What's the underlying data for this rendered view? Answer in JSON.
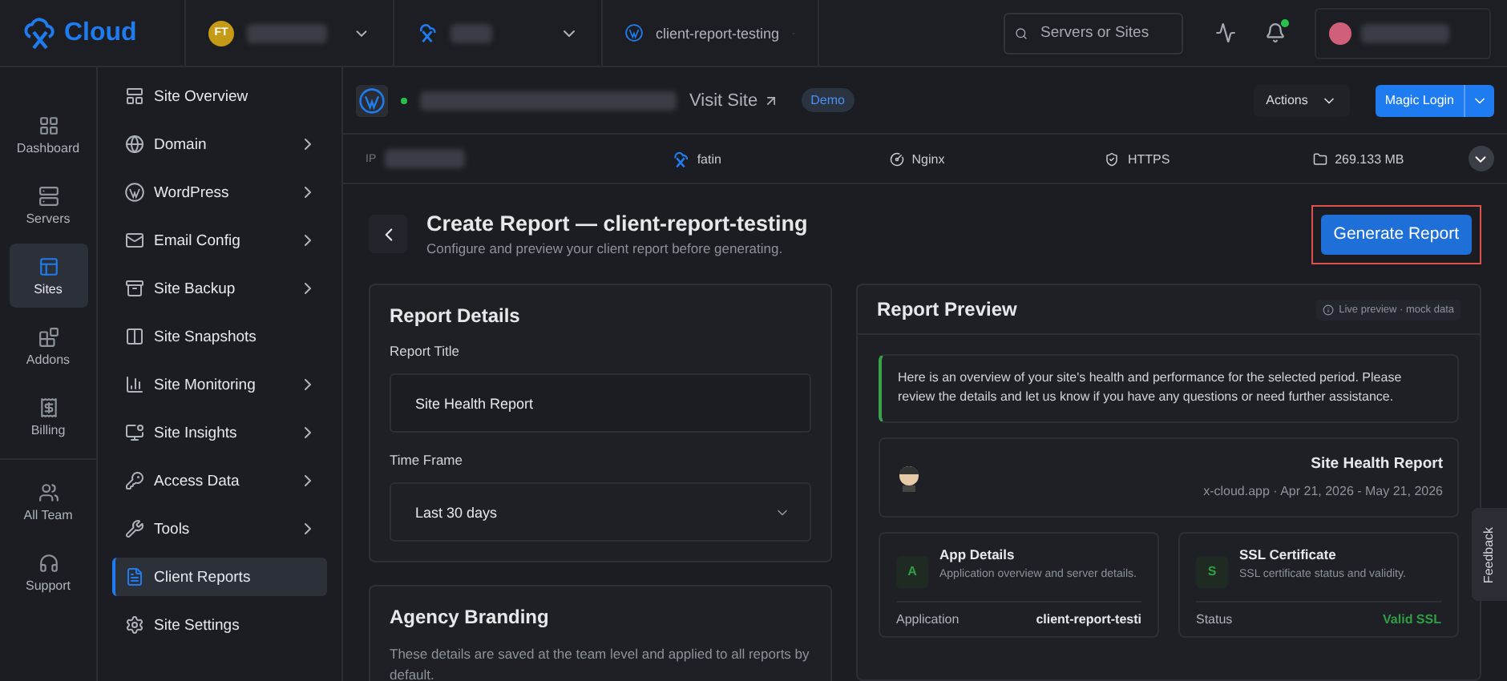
{
  "topbar": {
    "logo_text": "Cloud",
    "team": {
      "initials": "FT"
    },
    "site_crumb": "client-report-testing",
    "search": {
      "placeholder": "Servers or Sites"
    },
    "notifications": {
      "unread": true
    }
  },
  "rail": [
    {
      "label": "Dashboard",
      "selected": false
    },
    {
      "label": "Servers",
      "selected": false
    },
    {
      "label": "Sites",
      "selected": true
    },
    {
      "label": "Addons",
      "selected": false
    },
    {
      "label": "Billing",
      "selected": false
    },
    {
      "label": "All Team",
      "selected": false
    },
    {
      "label": "Support",
      "selected": false
    }
  ],
  "menu": [
    {
      "label": "Site Overview",
      "expandable": false,
      "selected": false
    },
    {
      "label": "Domain",
      "expandable": true,
      "selected": false
    },
    {
      "label": "WordPress",
      "expandable": true,
      "selected": false
    },
    {
      "label": "Email Config",
      "expandable": true,
      "selected": false
    },
    {
      "label": "Site Backup",
      "expandable": true,
      "selected": false
    },
    {
      "label": "Site Snapshots",
      "expandable": false,
      "selected": false
    },
    {
      "label": "Site Monitoring",
      "expandable": true,
      "selected": false
    },
    {
      "label": "Site Insights",
      "expandable": true,
      "selected": false
    },
    {
      "label": "Access Data",
      "expandable": true,
      "selected": false
    },
    {
      "label": "Tools",
      "expandable": true,
      "selected": false
    },
    {
      "label": "Client Reports",
      "expandable": false,
      "selected": true
    },
    {
      "label": "Site Settings",
      "expandable": false,
      "selected": false
    }
  ],
  "site_header": {
    "online": true,
    "visit_link": "Visit Site",
    "badge": "Demo",
    "actions": "Actions",
    "magic_login": "Magic Login"
  },
  "info_bar": {
    "ip_label": "IP",
    "owner": "fatin",
    "web_server": "Nginx",
    "protocol": "HTTPS",
    "disk": "269.133 MB"
  },
  "page": {
    "title": "Create Report — client-report-testing",
    "subtitle": "Configure and preview your client report before generating.",
    "generate_button": "Generate Report"
  },
  "report_details": {
    "heading": "Report Details",
    "title_label": "Report Title",
    "title_value": "Site Health Report",
    "timeframe_label": "Time Frame",
    "timeframe_value": "Last 30 days"
  },
  "agency_branding": {
    "heading": "Agency Branding",
    "description": "These details are saved at the team level and applied to all reports by default."
  },
  "preview": {
    "heading": "Report Preview",
    "note": "Live preview · mock data",
    "message": "Here is an overview of your site's health and performance for the selected period. Please review the details and let us know if you have any questions or need further assistance.",
    "report_title": "Site Health Report",
    "report_meta": "x-cloud.app · Apr 21, 2026 - May 21, 2026",
    "sections": [
      {
        "letter": "A",
        "title": "App Details",
        "description": "Application overview and server details.",
        "rows": [
          {
            "label": "Application",
            "value": "client-report-testi",
            "ok": false
          }
        ]
      },
      {
        "letter": "S",
        "title": "SSL Certificate",
        "description": "SSL certificate status and validity.",
        "rows": [
          {
            "label": "Status",
            "value": "Valid SSL",
            "ok": true
          }
        ]
      }
    ]
  },
  "feedback": "Feedback"
}
